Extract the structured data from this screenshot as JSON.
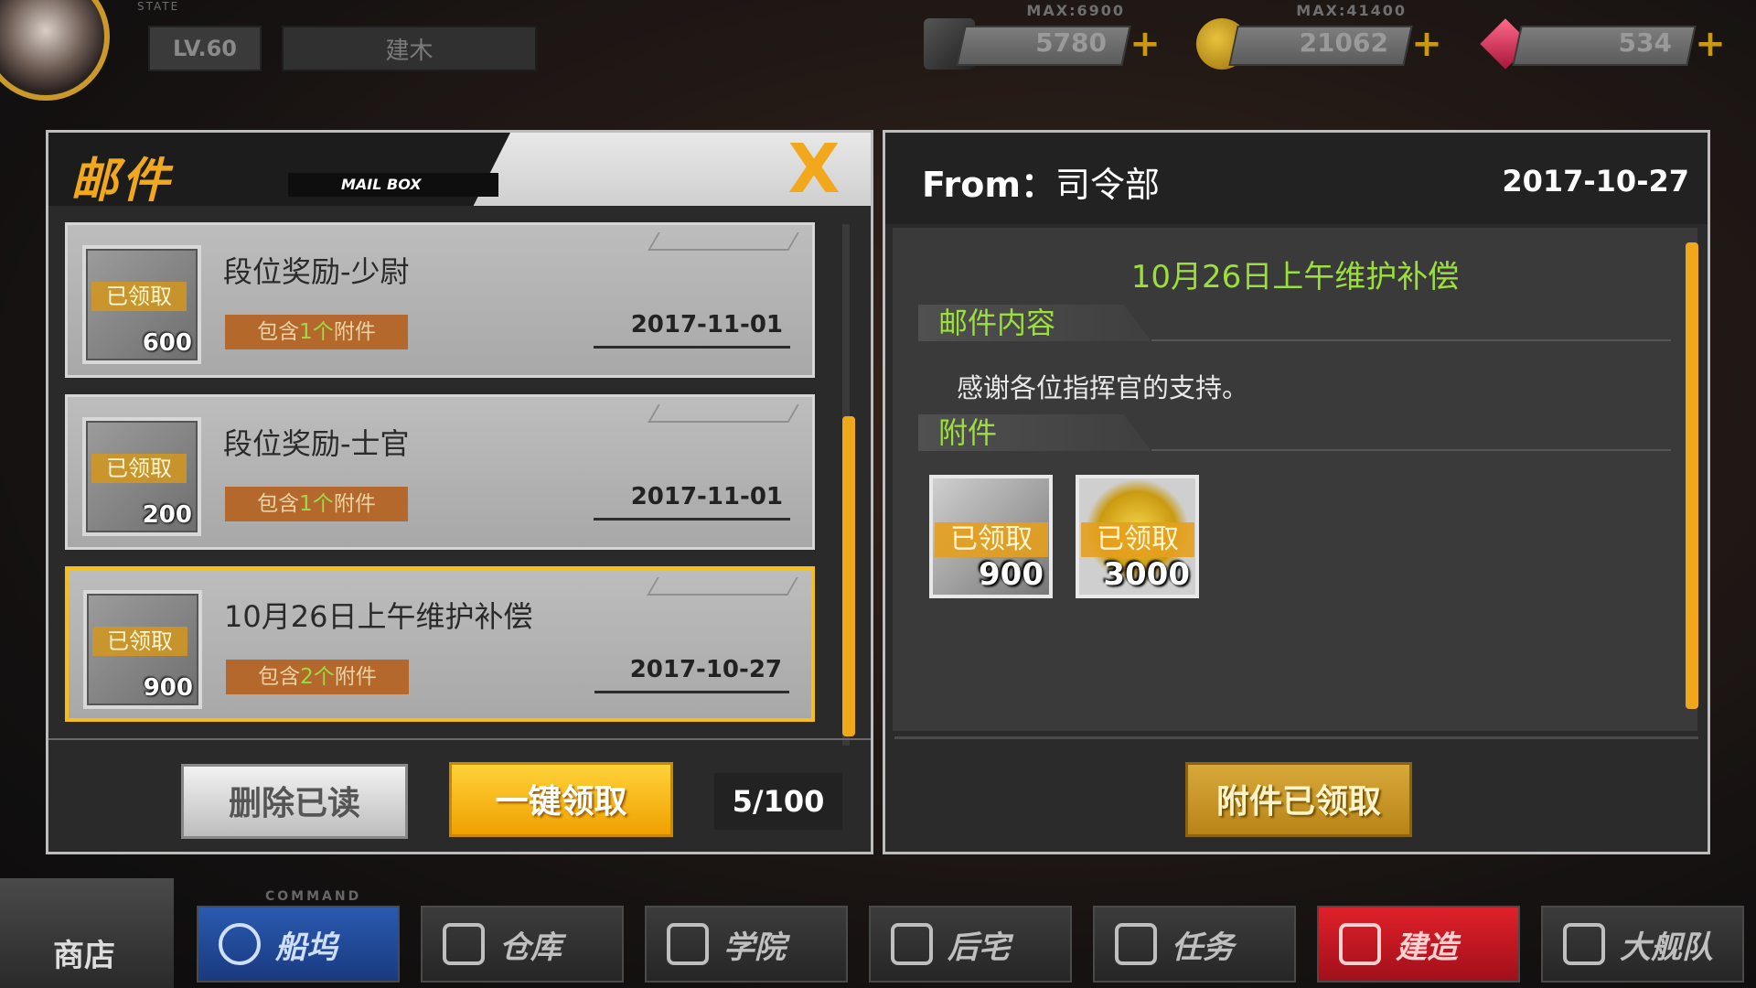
{
  "hud": {
    "state_label": "STATE",
    "level": "LV.60",
    "player_name": "建木",
    "resources": [
      {
        "icon": "ammo-icon",
        "max": "MAX:6900",
        "value": "5780"
      },
      {
        "icon": "coin-icon",
        "max": "MAX:41400",
        "value": "21062"
      },
      {
        "icon": "gem-icon",
        "max": "",
        "value": "534"
      }
    ],
    "plus_symbol": "+"
  },
  "mailbox": {
    "title": "邮件",
    "subtitle": "MAIL BOX",
    "close": "X",
    "mails": [
      {
        "subject": "段位奖励-少尉",
        "stamp": "已领取",
        "qty": "600",
        "attach_prefix": "包含",
        "attach_count": "1个",
        "attach_suffix": "附件",
        "date": "2017-11-01",
        "selected": false
      },
      {
        "subject": "段位奖励-士官",
        "stamp": "已领取",
        "qty": "200",
        "attach_prefix": "包含",
        "attach_count": "1个",
        "attach_suffix": "附件",
        "date": "2017-11-01",
        "selected": false
      },
      {
        "subject": "10月26日上午维护补偿",
        "stamp": "已领取",
        "qty": "900",
        "attach_prefix": "包含",
        "attach_count": "2个",
        "attach_suffix": "附件",
        "date": "2017-10-27",
        "selected": true
      }
    ],
    "delete_read": "删除已读",
    "claim_all": "一键领取",
    "count": "5/100"
  },
  "detail": {
    "from_label": "From：",
    "from_value": "司令部",
    "date": "2017-10-27",
    "title": "10月26日上午维护补偿",
    "content_header": "邮件内容",
    "content_text": "感谢各位指挥官的支持。",
    "attach_header": "附件",
    "items": [
      {
        "icon": "ammo-icon",
        "stamp": "已领取",
        "qty": "900"
      },
      {
        "icon": "coin-icon",
        "stamp": "已领取",
        "qty": "3000"
      }
    ],
    "claimed_button": "附件已领取"
  },
  "nav": {
    "command_label": "COMMAND",
    "shop": "商店",
    "buttons": [
      {
        "label": "船坞",
        "icon": "target-icon",
        "style": "blue"
      },
      {
        "label": "仓库",
        "icon": "warehouse-icon",
        "style": "normal"
      },
      {
        "label": "学院",
        "icon": "academy-icon",
        "style": "normal"
      },
      {
        "label": "后宅",
        "icon": "dorm-icon",
        "style": "normal"
      },
      {
        "label": "任务",
        "icon": "task-icon",
        "style": "normal"
      },
      {
        "label": "建造",
        "icon": "build-icon",
        "style": "red"
      },
      {
        "label": "大舰队",
        "icon": "fleet-icon",
        "style": "normal"
      }
    ]
  }
}
